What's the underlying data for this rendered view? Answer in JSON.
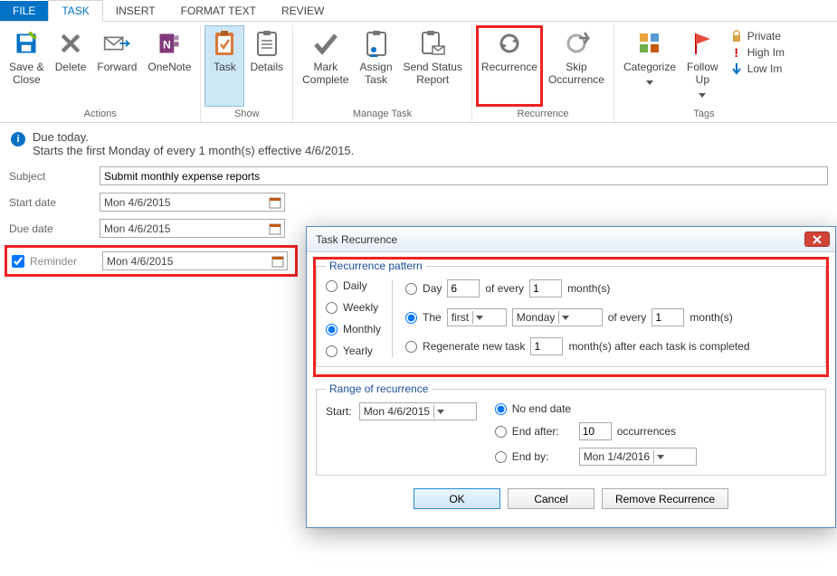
{
  "tabs": {
    "file": "FILE",
    "task": "TASK",
    "insert": "INSERT",
    "format": "FORMAT TEXT",
    "review": "REVIEW"
  },
  "ribbon": {
    "actions": {
      "label": "Actions",
      "save_close": "Save &\nClose",
      "delete": "Delete",
      "forward": "Forward",
      "onenote": "OneNote"
    },
    "show": {
      "label": "Show",
      "task": "Task",
      "details": "Details"
    },
    "manage": {
      "label": "Manage Task",
      "mark_complete": "Mark\nComplete",
      "assign_task": "Assign\nTask",
      "send_status": "Send Status\nReport"
    },
    "recurrence_group": {
      "label": "Recurrence",
      "recurrence": "Recurrence",
      "skip": "Skip\nOccurrence"
    },
    "tags": {
      "label": "Tags",
      "categorize": "Categorize",
      "followup": "Follow\nUp",
      "private": "Private",
      "high": "High Im",
      "low": "Low Im"
    }
  },
  "info": {
    "line1": "Due today.",
    "line2": "Starts the first Monday of every 1 month(s) effective 4/6/2015."
  },
  "form": {
    "subject_label": "Subject",
    "subject_value": "Submit monthly expense reports",
    "start_label": "Start date",
    "start_value": "Mon 4/6/2015",
    "due_label": "Due date",
    "due_value": "Mon 4/6/2015",
    "reminder_label": "Reminder",
    "reminder_value": "Mon 4/6/2015"
  },
  "dialog": {
    "title": "Task Recurrence",
    "pattern_legend": "Recurrence pattern",
    "freq": {
      "daily": "Daily",
      "weekly": "Weekly",
      "monthly": "Monthly",
      "yearly": "Yearly"
    },
    "opt_day": "Day",
    "opt_day_value": "6",
    "opt_day_mid": "of every",
    "opt_day_months": "1",
    "opt_day_suffix": "month(s)",
    "opt_the": "The",
    "opt_the_ord": "first",
    "opt_the_dow": "Monday",
    "opt_the_mid": "of every",
    "opt_the_months": "1",
    "opt_the_suffix": "month(s)",
    "opt_regen": "Regenerate new task",
    "opt_regen_value": "1",
    "opt_regen_suffix": "month(s) after each task is completed",
    "range_legend": "Range of recurrence",
    "range_start_label": "Start:",
    "range_start_value": "Mon 4/6/2015",
    "range_noend": "No end date",
    "range_endafter": "End after:",
    "range_endafter_value": "10",
    "range_endafter_suffix": "occurrences",
    "range_endby": "End by:",
    "range_endby_value": "Mon 1/4/2016",
    "btn_ok": "OK",
    "btn_cancel": "Cancel",
    "btn_remove": "Remove Recurrence"
  }
}
